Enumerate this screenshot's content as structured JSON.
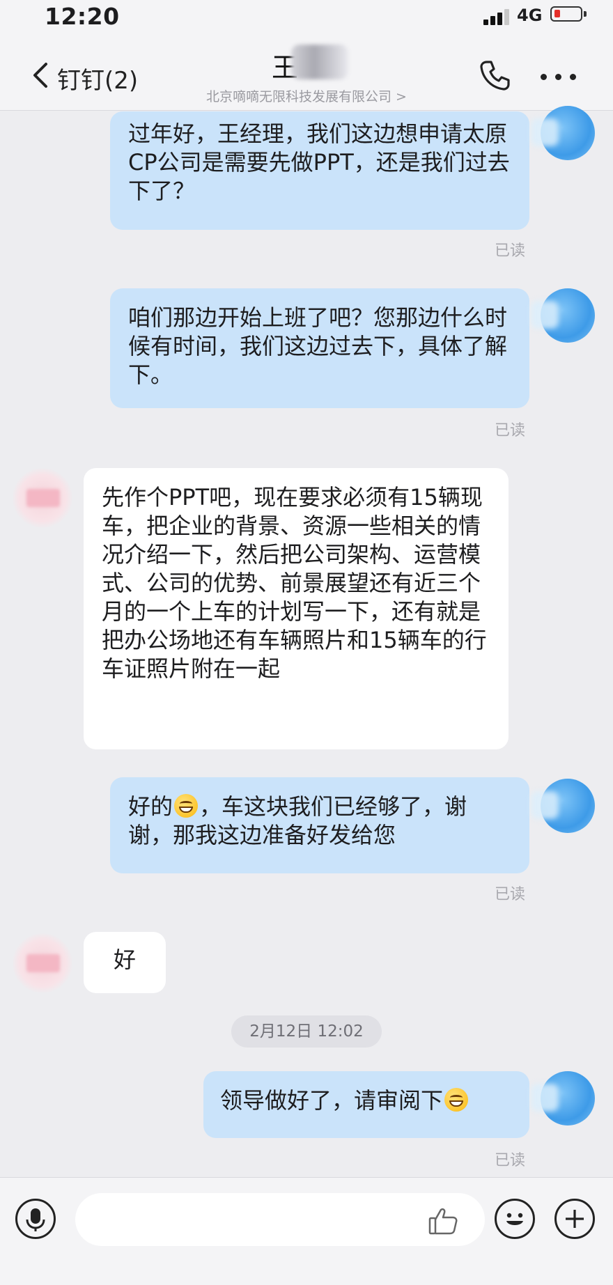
{
  "status": {
    "time": "12:20",
    "network": "4G"
  },
  "nav": {
    "back_label": "钉钉(2)",
    "title": "王",
    "subtitle": "北京嘀嘀无限科技发展有限公司 >"
  },
  "messages": [
    {
      "text": "过年好，王经理，我们这边想申请太原CP公司是需要先做PPT，还是我们过去下了？",
      "status": "已读"
    },
    {
      "text": "咱们那边开始上班了吧？您那边什么时候有时间，我们这边过去下，具体了解下。",
      "status": "已读"
    },
    {
      "text": "先作个PPT吧，现在要求必须有15辆现车，把企业的背景、资源一些相关的情况介绍一下，然后把公司架构、运营模式、公司的优势、前景展望还有近三个月的一个上车的计划写一下，还有就是把办公场地还有车辆照片和15辆车的行车证照片附在一起"
    },
    {
      "text_before_emoji": "好的",
      "text_after_emoji": "，车这块我们已经够了，谢谢，那我这边准备好发给您",
      "status": "已读"
    },
    {
      "text": "好"
    },
    {
      "text": "领导做好了，请审阅下",
      "status": "已读"
    }
  ],
  "date_divider": "2月12日 12:02",
  "icons": {
    "back": "chevron-left-icon",
    "phone": "phone-icon",
    "more": "more-icon",
    "mic": "microphone-icon",
    "thumb": "thumbs-up-icon",
    "emoji": "emoji-icon",
    "plus": "plus-icon"
  },
  "colors": {
    "my_bubble": "#cae3fa",
    "their_bubble": "#ffffff",
    "background": "#ededf0"
  }
}
